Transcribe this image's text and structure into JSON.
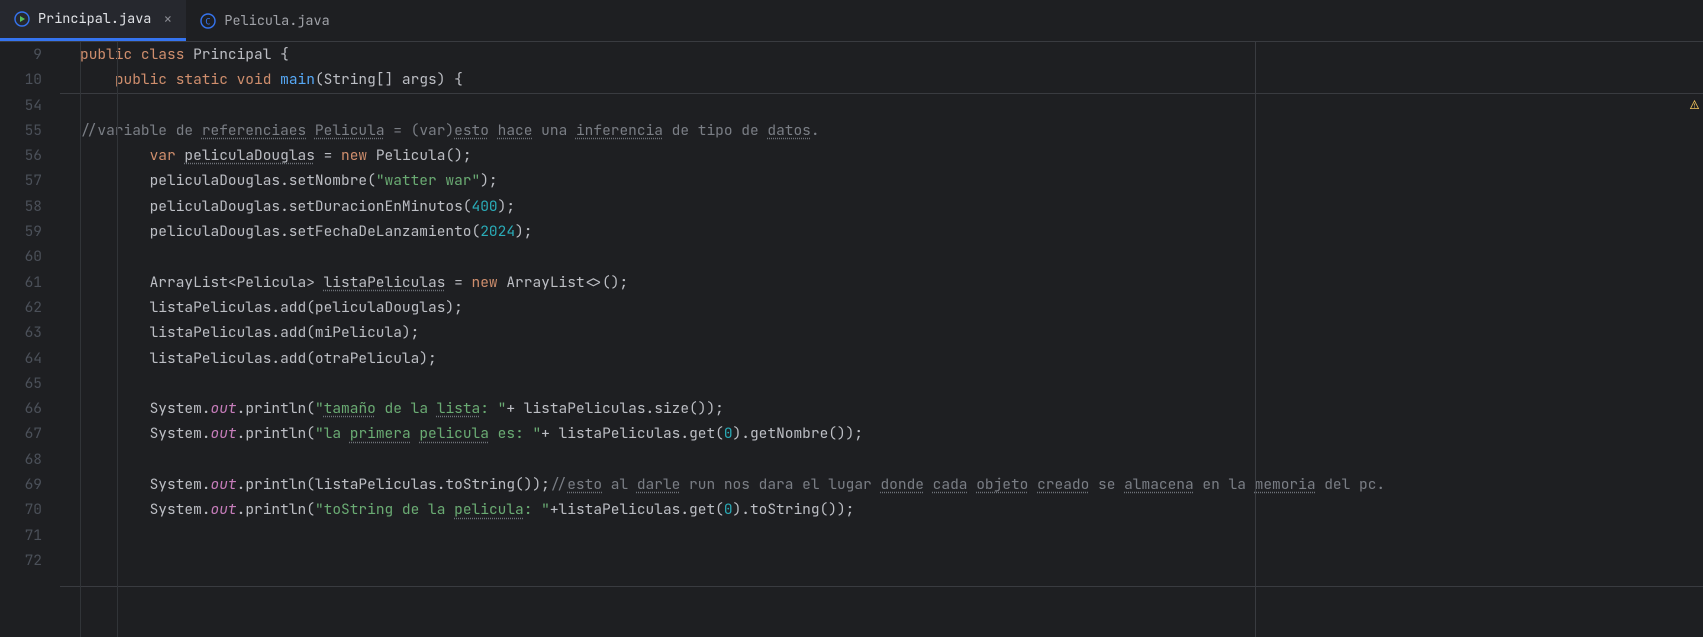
{
  "tabs": [
    {
      "label": "Principal.java",
      "active": true,
      "icon": "class-run"
    },
    {
      "label": "Pelicula.java",
      "active": false,
      "icon": "class"
    }
  ],
  "gutter_lines": [
    "9",
    "10",
    "54",
    "55",
    "56",
    "57",
    "58",
    "59",
    "60",
    "61",
    "62",
    "63",
    "64",
    "65",
    "66",
    "67",
    "68",
    "69",
    "70",
    "71",
    "72"
  ],
  "code": {
    "l9": {
      "t": [
        [
          "kw",
          "public class "
        ],
        [
          "id",
          "Principal {"
        ]
      ]
    },
    "l10": {
      "indent": "    ",
      "t": [
        [
          "kw",
          "public static void "
        ],
        [
          "fn",
          "main"
        ],
        [
          "id",
          "(String[] args) {"
        ]
      ]
    },
    "l54": {
      "t": []
    },
    "l55": {
      "t": [
        [
          "cmt",
          "//variable de "
        ],
        [
          "cmt warn",
          "referenciaes"
        ],
        [
          "cmt",
          " "
        ],
        [
          "cmt warn",
          "Pelicula"
        ],
        [
          "cmt",
          " = (var)"
        ],
        [
          "cmt warn",
          "esto"
        ],
        [
          "cmt",
          " "
        ],
        [
          "cmt warn",
          "hace"
        ],
        [
          "cmt",
          " una "
        ],
        [
          "cmt warn",
          "inferencia"
        ],
        [
          "cmt",
          " de tipo de "
        ],
        [
          "cmt warn",
          "datos"
        ],
        [
          "cmt",
          "."
        ]
      ]
    },
    "l56": {
      "indent": "        ",
      "t": [
        [
          "kw",
          "var "
        ],
        [
          "id warn",
          "peliculaDouglas"
        ],
        [
          "id",
          " = "
        ],
        [
          "kw",
          "new "
        ],
        [
          "id",
          "Pelicula();"
        ]
      ]
    },
    "l57": {
      "indent": "        ",
      "t": [
        [
          "id",
          "peliculaDouglas.setNombre("
        ],
        [
          "str",
          "\"watter war\""
        ],
        [
          "id",
          ");"
        ]
      ]
    },
    "l58": {
      "indent": "        ",
      "t": [
        [
          "id",
          "peliculaDouglas.setDuracionEnMinutos("
        ],
        [
          "num",
          "400"
        ],
        [
          "id",
          ");"
        ]
      ]
    },
    "l59": {
      "indent": "        ",
      "t": [
        [
          "id",
          "peliculaDouglas.setFechaDeLanzamiento("
        ],
        [
          "num",
          "2024"
        ],
        [
          "id",
          ");"
        ]
      ]
    },
    "l60": {
      "t": []
    },
    "l61": {
      "indent": "        ",
      "t": [
        [
          "id",
          "ArrayList<Pelicula> "
        ],
        [
          "id warn",
          "listaPeliculas"
        ],
        [
          "id",
          " = "
        ],
        [
          "kw",
          "new "
        ],
        [
          "id",
          "ArrayList<>();"
        ]
      ]
    },
    "l62": {
      "indent": "        ",
      "t": [
        [
          "id",
          "listaPeliculas.add(peliculaDouglas);"
        ]
      ]
    },
    "l63": {
      "indent": "        ",
      "t": [
        [
          "id",
          "listaPeliculas.add(miPelicula);"
        ]
      ]
    },
    "l64": {
      "indent": "        ",
      "t": [
        [
          "id",
          "listaPeliculas.add(otraPelicula);"
        ]
      ]
    },
    "l65": {
      "t": []
    },
    "l66": {
      "indent": "        ",
      "t": [
        [
          "id",
          "System."
        ],
        [
          "fld",
          "out"
        ],
        [
          "id",
          ".println("
        ],
        [
          "str",
          "\""
        ],
        [
          "str warn",
          "tamaño"
        ],
        [
          "str",
          " de la "
        ],
        [
          "str warn",
          "lista"
        ],
        [
          "str",
          ": \""
        ],
        [
          "id",
          "+ listaPeliculas.size());"
        ]
      ]
    },
    "l67": {
      "indent": "        ",
      "t": [
        [
          "id",
          "System."
        ],
        [
          "fld",
          "out"
        ],
        [
          "id",
          ".println("
        ],
        [
          "str",
          "\"la "
        ],
        [
          "str warn",
          "primera"
        ],
        [
          "str",
          " "
        ],
        [
          "str warn",
          "pelicula"
        ],
        [
          "str",
          " es: \""
        ],
        [
          "id",
          "+ listaPeliculas.get("
        ],
        [
          "num",
          "0"
        ],
        [
          "id",
          ").getNombre());"
        ]
      ]
    },
    "l68": {
      "t": []
    },
    "l69": {
      "indent": "        ",
      "t": [
        [
          "id",
          "System."
        ],
        [
          "fld",
          "out"
        ],
        [
          "id",
          ".println(listaPeliculas.toString());"
        ],
        [
          "cmt",
          "//"
        ],
        [
          "cmt warn",
          "esto"
        ],
        [
          "cmt",
          " al "
        ],
        [
          "cmt warn",
          "darle"
        ],
        [
          "cmt",
          " run nos dara el lugar "
        ],
        [
          "cmt warn",
          "donde"
        ],
        [
          "cmt",
          " "
        ],
        [
          "cmt warn",
          "cada"
        ],
        [
          "cmt",
          " "
        ],
        [
          "cmt warn",
          "objeto"
        ],
        [
          "cmt",
          " "
        ],
        [
          "cmt warn",
          "creado"
        ],
        [
          "cmt",
          " se "
        ],
        [
          "cmt warn",
          "almacena"
        ],
        [
          "cmt",
          " en la "
        ],
        [
          "cmt warn",
          "memoria"
        ],
        [
          "cmt",
          " del pc."
        ]
      ]
    },
    "l70": {
      "indent": "        ",
      "t": [
        [
          "id",
          "System."
        ],
        [
          "fld",
          "out"
        ],
        [
          "id",
          ".println("
        ],
        [
          "str",
          "\"toString de la "
        ],
        [
          "str warn",
          "pelicula"
        ],
        [
          "str",
          ": \""
        ],
        [
          "id",
          "+listaPeliculas.get("
        ],
        [
          "num",
          "0"
        ],
        [
          "id",
          ").toString());"
        ]
      ]
    },
    "l71": {
      "t": []
    },
    "l72": {
      "t": []
    }
  }
}
